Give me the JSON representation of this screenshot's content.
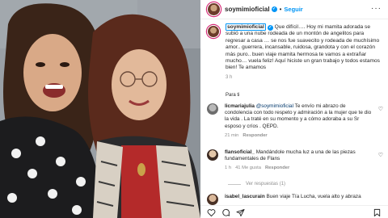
{
  "post": {
    "username": "soymimioficial",
    "verified_glyph": "✓",
    "separator": "•",
    "follow_label": "Seguir",
    "more_glyph": "···"
  },
  "caption": {
    "username": "soymimioficial",
    "text": " Que difícil…. Hoy mi mamita adorada se subió a una nube rodeada de un montón de angelitos para regresar a casa … se nos fue suavecito y rodeada de muchísimo amor.. guerrera, incansable, ruidosa, grandota y con el corazón más puro.. buen viaje mamita hermosa te vamos a extrañar mucho… vuela feliz! Aquí hiciste un gran trabajo y todos estamos bien! Te amamos",
    "time": "3 h"
  },
  "translate_label": "Para ti",
  "comments": [
    {
      "username": "licmariajulia",
      "mention": "@soymimioficial",
      "text": " Te envío mi abrazo de condolencia con todo respeto y admiración a la mujer que te dio la vida . La traté en su momento y a cómo adoraba a su Sr esposo y críos . QEPD.",
      "time": "21 min",
      "likes": "",
      "reply_label": "Responder"
    },
    {
      "username": "flansoficial_",
      "mention": "",
      "text": " Mandándole mucha luz a una de las piezas fundamentales de Flans",
      "time": "1 h",
      "likes": "41 Me gusta",
      "reply_label": "Responder"
    },
    {
      "username": "isabel_lascurain",
      "mention": "",
      "text": " Buen viaje Tía Lucha, vuela alto y abraza",
      "time": "",
      "likes": "",
      "reply_label": ""
    }
  ],
  "view_replies": "Ver respuestas (1)",
  "icons": {
    "heart": "heart-icon",
    "comment": "comment-icon",
    "share": "share-icon",
    "save": "bookmark-icon",
    "more": "more-icon"
  },
  "colors": {
    "accent": "#0095f6",
    "text": "#262626",
    "muted": "#8e8e8e",
    "mention": "#00376b"
  }
}
